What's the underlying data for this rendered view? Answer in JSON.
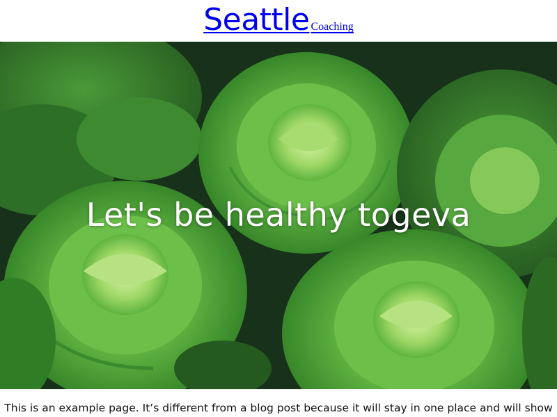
{
  "header": {
    "brand_main": "Seattle",
    "brand_sub": "Coaching"
  },
  "hero": {
    "title": "Let's be healthy togeva",
    "image_icon": "lettuce-photo",
    "colors": {
      "background": "#17311a",
      "leaf_dark": "#2f7d25",
      "leaf_mid": "#46a53a",
      "leaf_light": "#8fd45a",
      "leaf_core": "#c4ea8e"
    }
  },
  "content": {
    "intro": "This is an example page. It’s different from a blog post because it will stay in one place and will show"
  }
}
